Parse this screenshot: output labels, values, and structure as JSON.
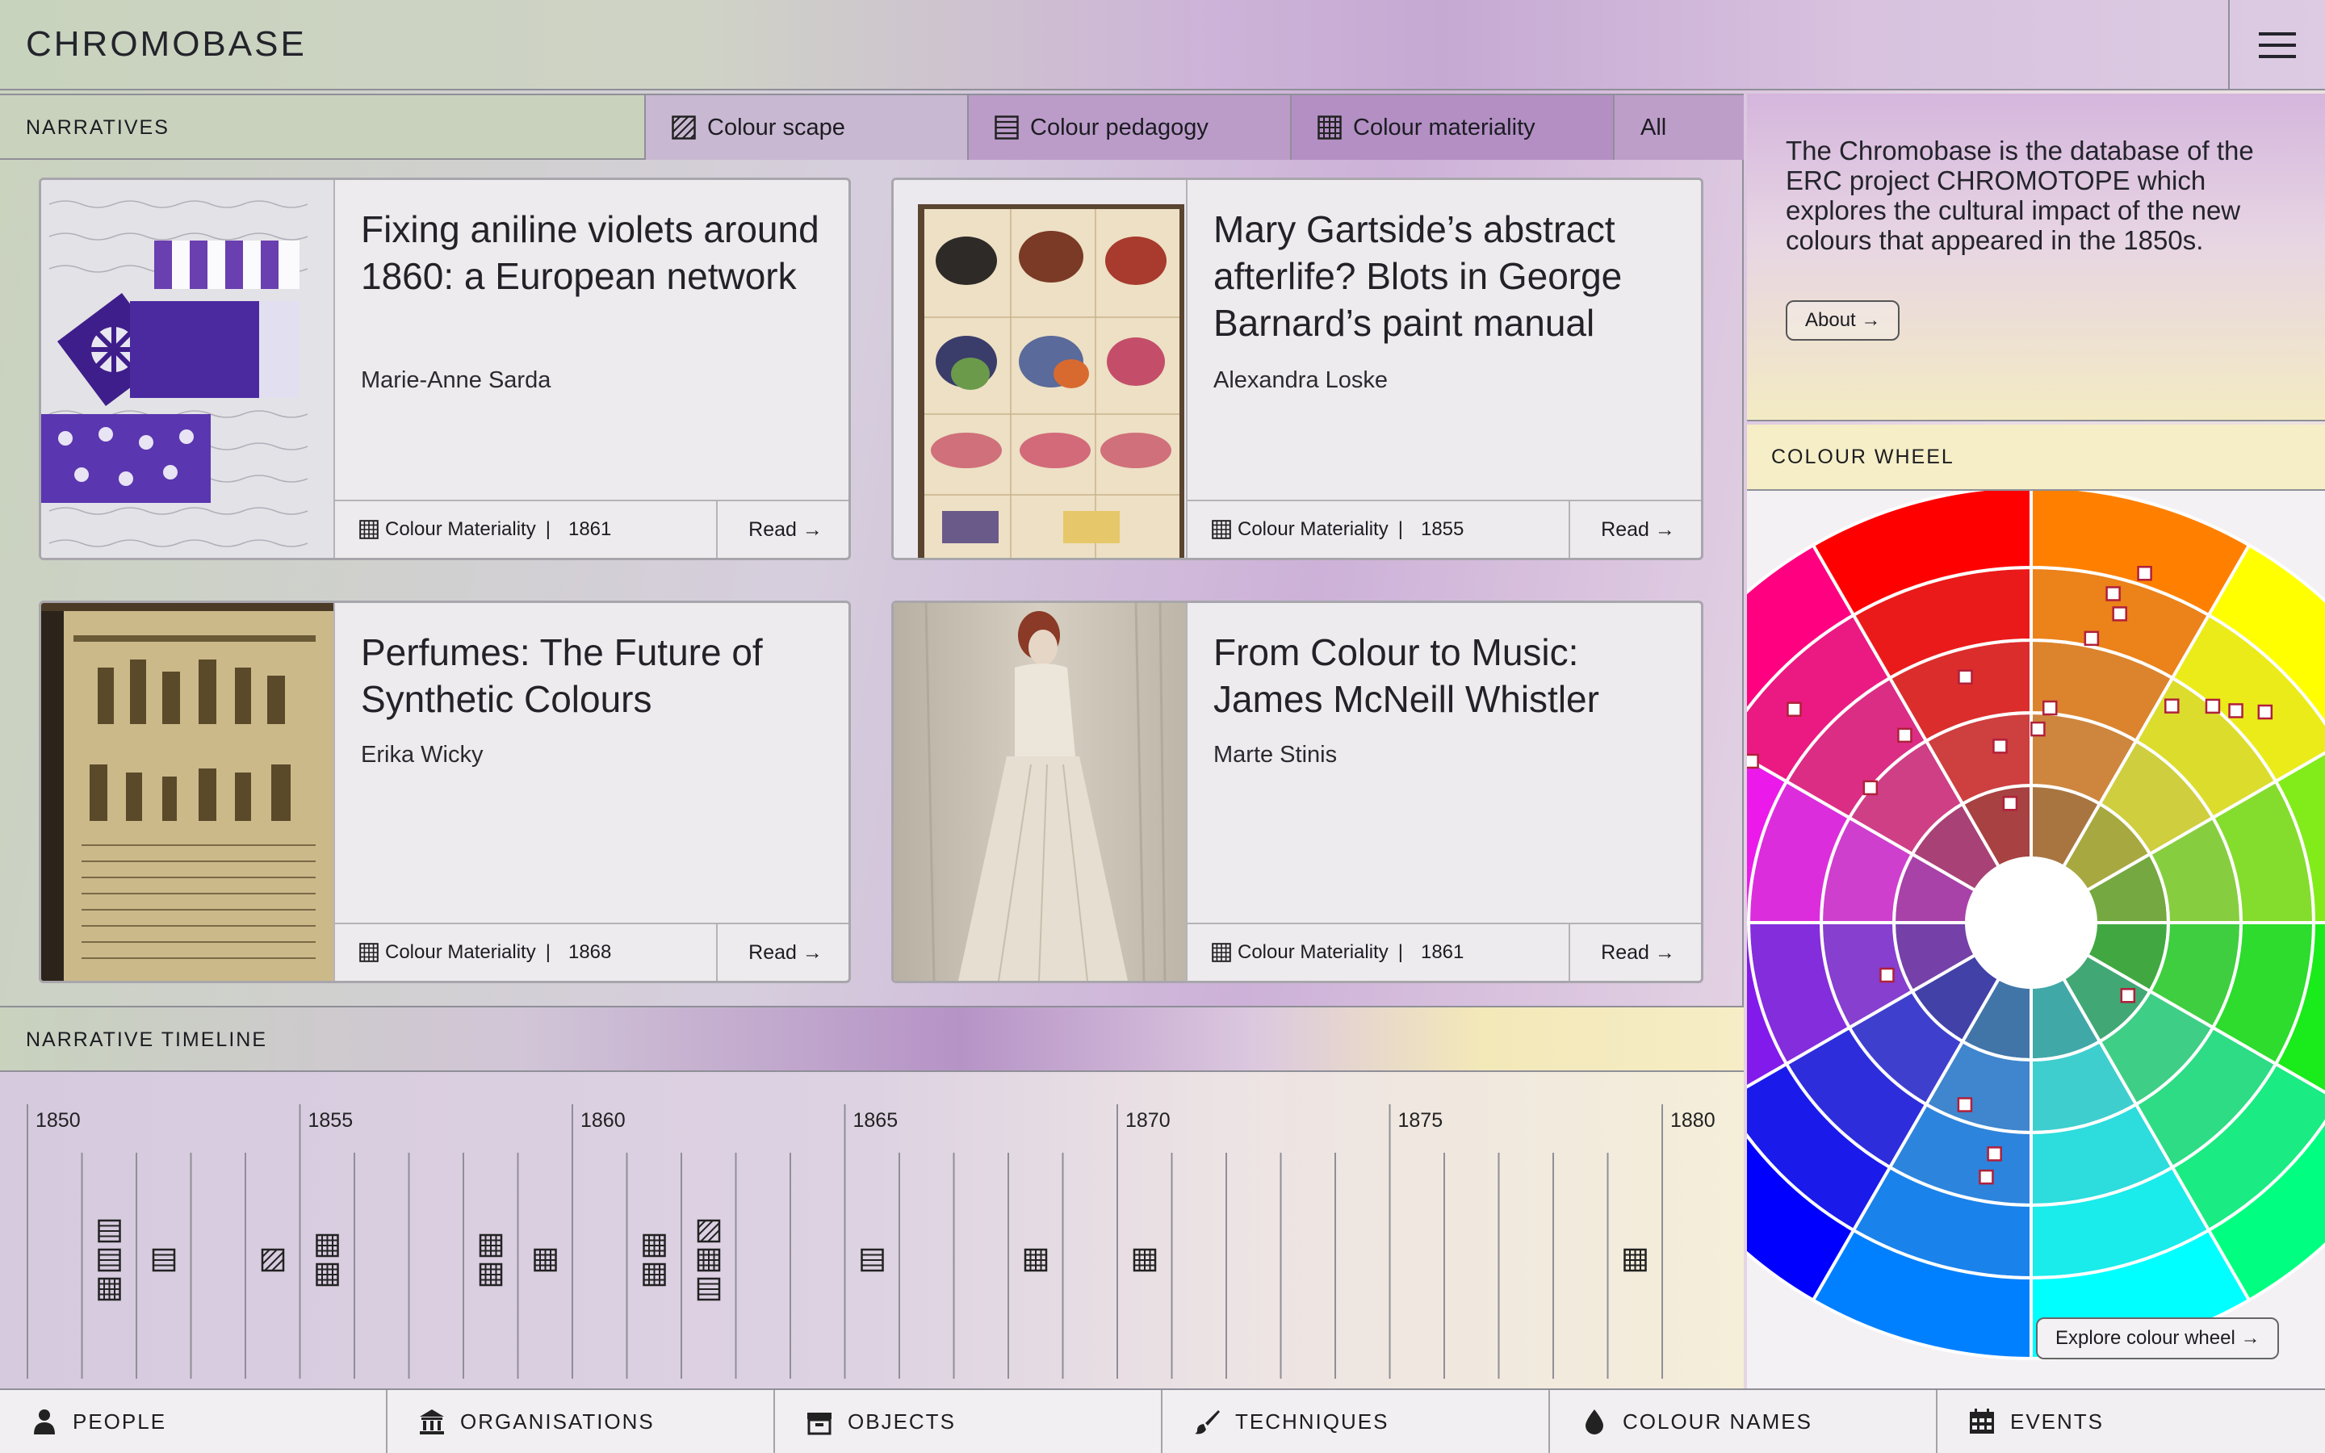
{
  "header": {
    "logo": "CHROMOBASE"
  },
  "narratives": {
    "title": "NARRATIVES",
    "filters": [
      {
        "label": "Colour scape",
        "icon": "hatch-icon"
      },
      {
        "label": "Colour pedagogy",
        "icon": "lines-icon"
      },
      {
        "label": "Colour materiality",
        "icon": "grid-icon"
      },
      {
        "label": "All",
        "icon": ""
      }
    ],
    "cards": [
      {
        "title": "Fixing aniline violets around 1860: a European network",
        "author": "Marie-Anne Sarda",
        "category": "Colour Materiality",
        "year": "1861",
        "read": "Read →"
      },
      {
        "title": "Mary Gartside’s abstract afterlife? Blots in George Barnard’s paint manual",
        "author": "Alexandra Loske",
        "category": "Colour Materiality",
        "year": "1855",
        "read": "Read →"
      },
      {
        "title": "Perfumes: The Future of Synthetic Colours",
        "author": "Erika Wicky",
        "category": "Colour Materiality",
        "year": "1868",
        "read": "Read →"
      },
      {
        "title": "From Colour to Music: James McNeill Whistler",
        "author": "Marte Stinis",
        "category": "Colour Materiality",
        "year": "1861",
        "read": "Read →"
      }
    ],
    "separator": "|"
  },
  "timeline": {
    "title": "NARRATIVE TIMELINE",
    "years": [
      "1850",
      "1855",
      "1860",
      "1865",
      "1870",
      "1875",
      "1880"
    ],
    "entries": [
      {
        "year": 1851,
        "stack": [
          "lines",
          "lines",
          "grid"
        ]
      },
      {
        "year": 1852,
        "stack": [
          "lines"
        ]
      },
      {
        "year": 1854,
        "stack": [
          "hatch"
        ]
      },
      {
        "year": 1855,
        "stack": [
          "grid",
          "grid"
        ]
      },
      {
        "year": 1858,
        "stack": [
          "grid",
          "grid"
        ]
      },
      {
        "year": 1859,
        "stack": [
          "grid"
        ]
      },
      {
        "year": 1861,
        "stack": [
          "grid",
          "grid"
        ]
      },
      {
        "year": 1862,
        "stack": [
          "hatch",
          "grid",
          "lines"
        ]
      },
      {
        "year": 1865,
        "stack": [
          "lines"
        ]
      },
      {
        "year": 1868,
        "stack": [
          "grid"
        ]
      },
      {
        "year": 1870,
        "stack": [
          "grid"
        ]
      },
      {
        "year": 1879,
        "stack": [
          "grid"
        ]
      }
    ]
  },
  "about": {
    "text": "The Chromobase is the database of the ERC project CHROMOTOPE which explores the cultural impact of the new colours that appeared in the 1850s.",
    "button": "About →"
  },
  "colour_wheel": {
    "title": "COLOUR WHEEL",
    "explore": "Explore colour wheel →"
  },
  "bottom_nav": [
    {
      "label": "PEOPLE",
      "icon": "person-icon"
    },
    {
      "label": "ORGANISATIONS",
      "icon": "institution-icon"
    },
    {
      "label": "OBJECTS",
      "icon": "box-icon"
    },
    {
      "label": "TECHNIQUES",
      "icon": "brush-icon"
    },
    {
      "label": "COLOUR NAMES",
      "icon": "drop-icon"
    },
    {
      "label": "EVENTS",
      "icon": "calendar-icon"
    }
  ]
}
